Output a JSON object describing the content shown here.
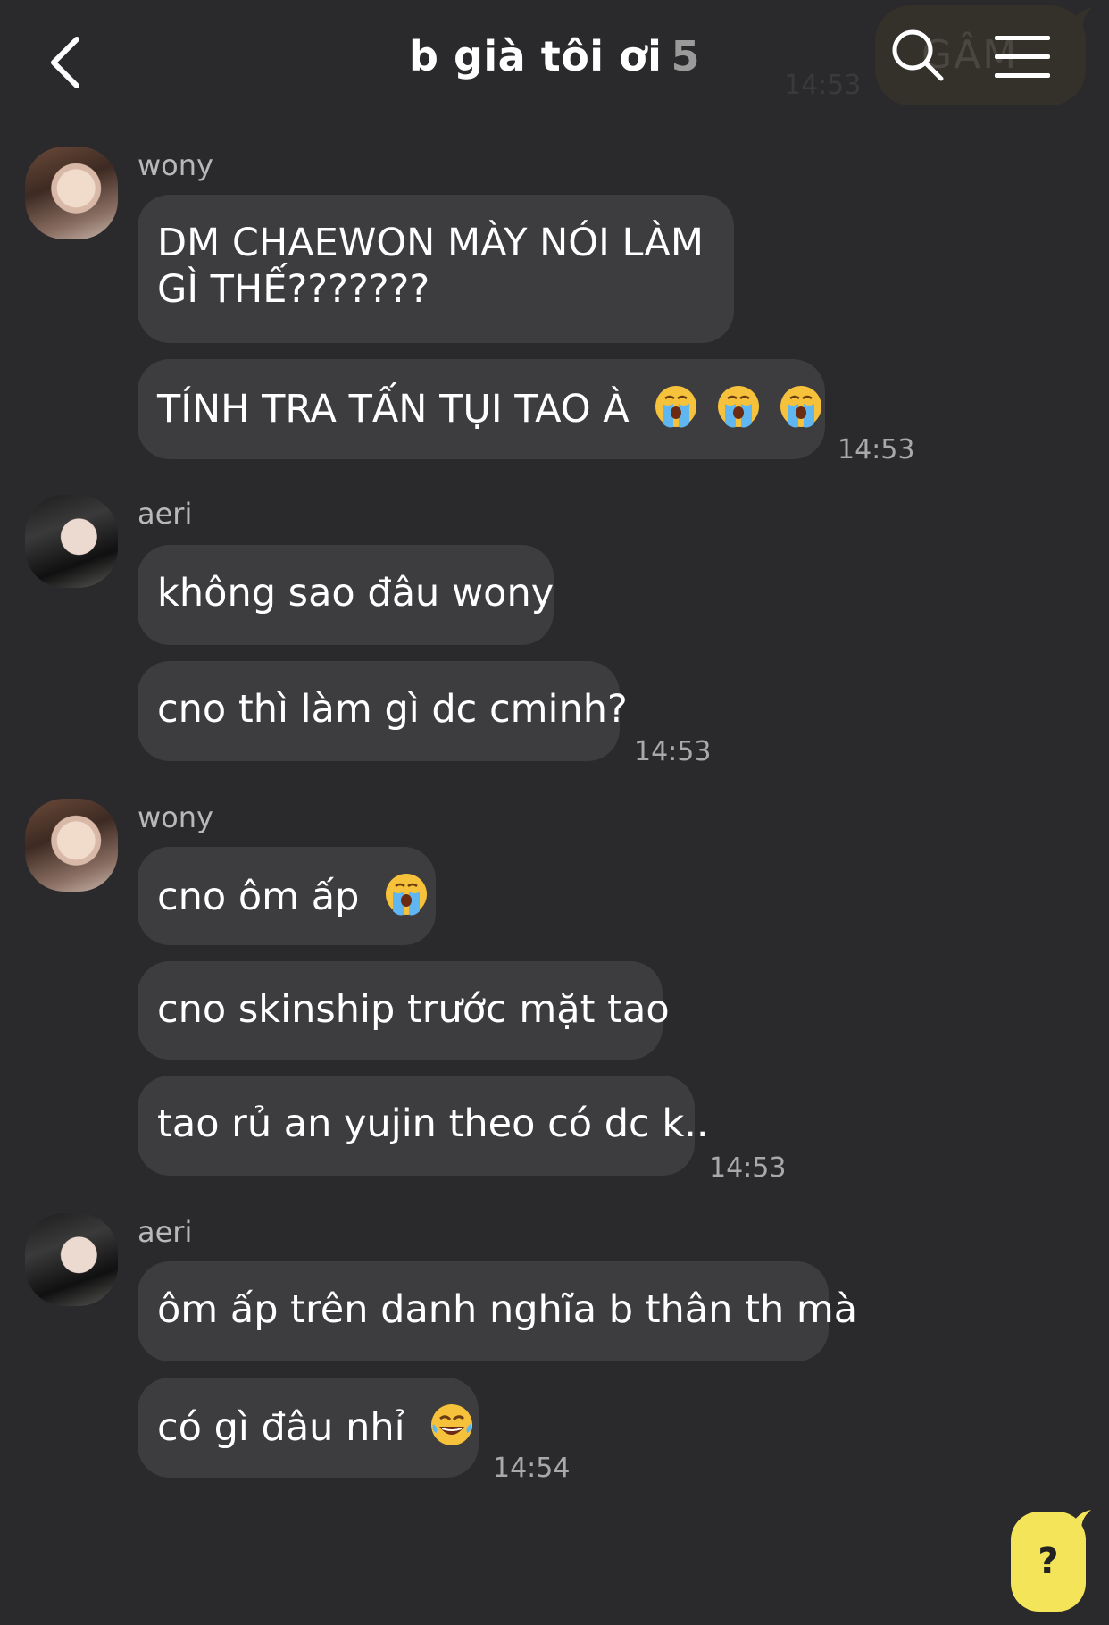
{
  "header": {
    "back_icon": "chevron-left-icon",
    "title": "b già tôi ơi",
    "member_count": "5",
    "ghost_time": "14:53",
    "ghost_word": "GÂM",
    "search_icon": "search-icon",
    "menu_icon": "menu-icon"
  },
  "groups": [
    {
      "sender": "wony",
      "messages": [
        "DM CHAEWON MÀY NÓI LÀM",
        "GÌ THẾ???????",
        "TÍNH TRA TẤN TỤI TAO À"
      ],
      "time": "14:53"
    },
    {
      "sender": "aeri",
      "messages": [
        "không sao đâu wony",
        "cno thì làm gì dc cminh?"
      ],
      "time": "14:53"
    },
    {
      "sender": "wony",
      "messages": [
        "cno ôm ấp",
        "cno skinship trước mặt tao",
        "tao rủ an yujin theo có dc k.."
      ],
      "time": "14:53"
    },
    {
      "sender": "aeri",
      "messages": [
        "ôm ấp trên danh nghĩa b thân th mà",
        "có gì đâu nhỉ"
      ],
      "time": "14:54"
    }
  ],
  "help_button": {
    "label": "?"
  },
  "colors": {
    "background": "#2a2a2d",
    "bubble": "#3d3d40",
    "accent_yellow": "#f4e45a",
    "tool_bg": "#34302a"
  }
}
